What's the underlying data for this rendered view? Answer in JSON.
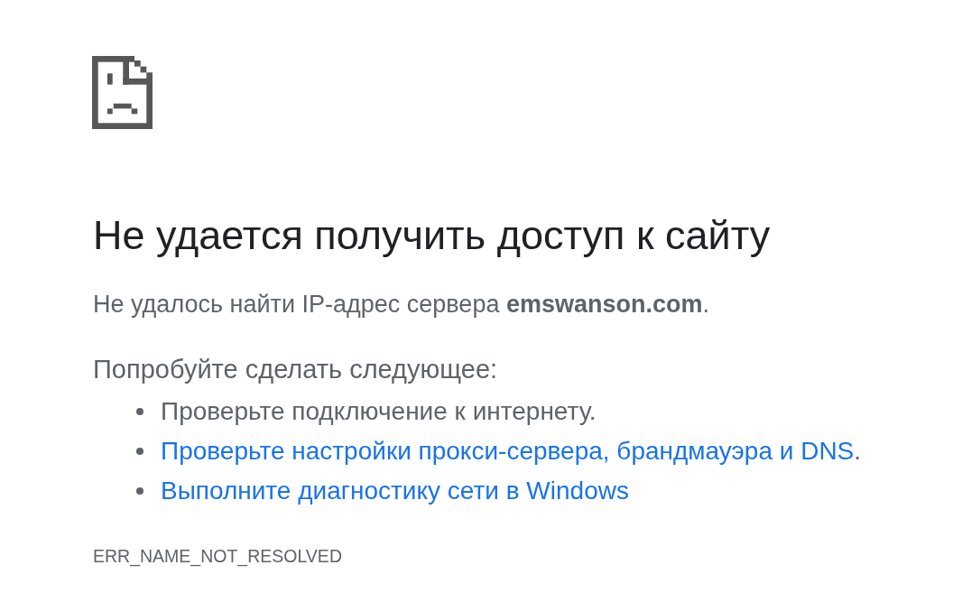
{
  "heading": "Не удается получить доступ к сайту",
  "message": "Не удалось найти IP-адрес сервера **emswanson.com**.",
  "suggestions_title": "Попробуйте сделать следующее:",
  "suggestions": [
    {
      "kind": "text",
      "text": "Проверьте подключение к интернету."
    },
    {
      "kind": "link",
      "text": "Проверьте настройки прокси-сервера, брандмауэра и DNS",
      "after": "."
    },
    {
      "kind": "link",
      "text": "Выполните диагностику сети в Windows"
    }
  ],
  "error_code": "ERR_NAME_NOT_RESOLVED"
}
